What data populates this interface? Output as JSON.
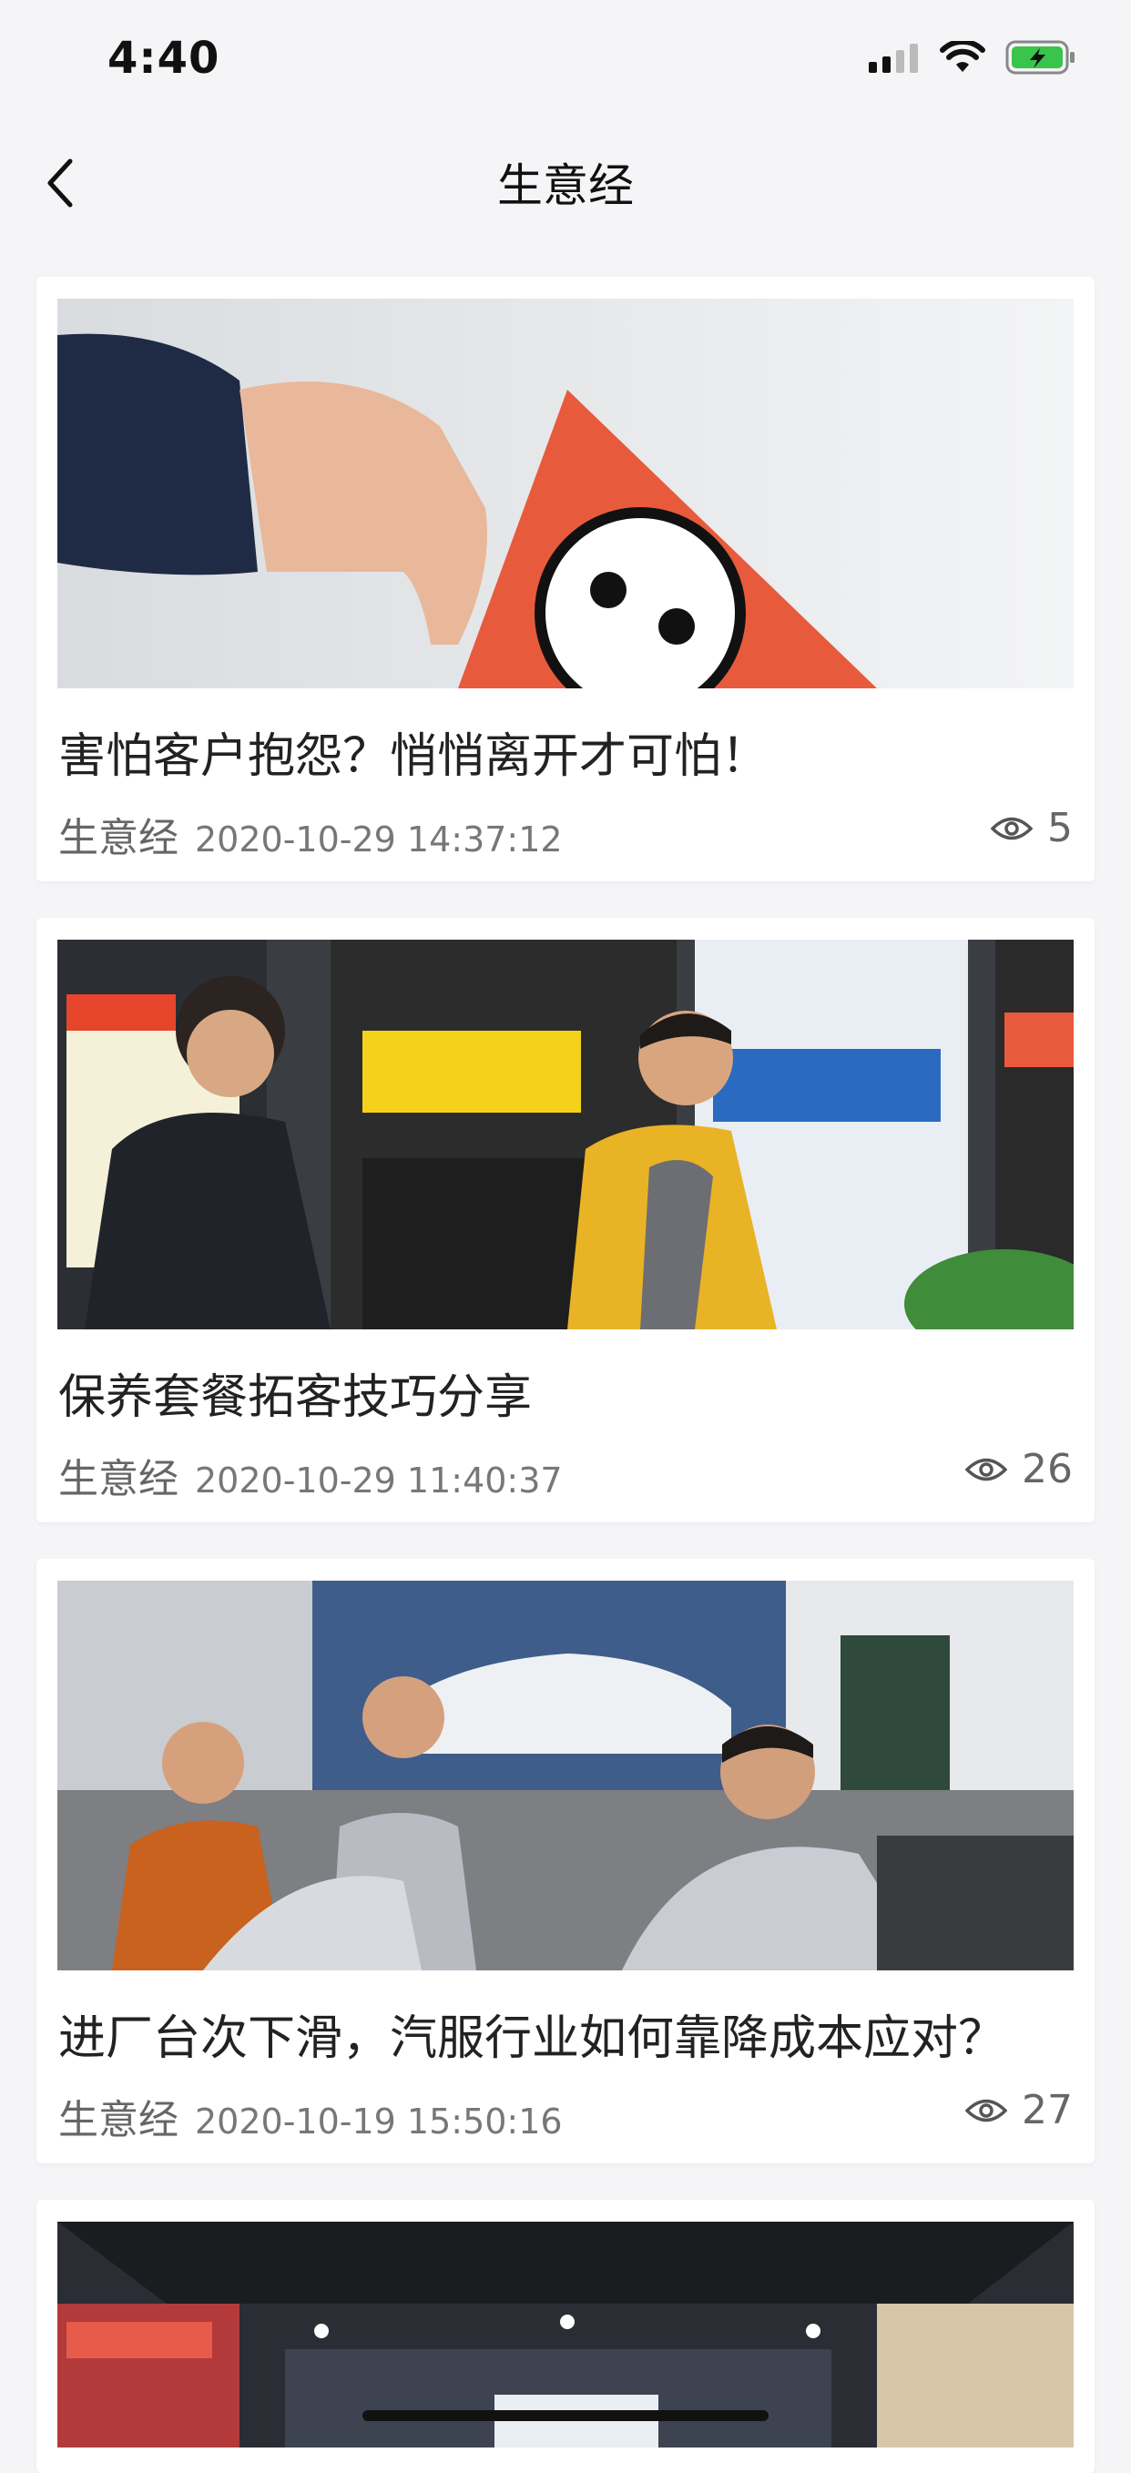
{
  "status_bar": {
    "time": "4:40",
    "icons": [
      "cellular-signal-icon",
      "wifi-icon",
      "battery-charging-icon"
    ],
    "battery_color": "#39c44b"
  },
  "nav": {
    "back_icon": "chevron-left-icon",
    "title": "生意经"
  },
  "articles": [
    {
      "title": "害怕客户抱怨？悄悄离开才可怕！",
      "category": "生意经",
      "date": "2020-10-29 14:37:12",
      "views": "5",
      "view_icon": "eye-icon",
      "image": "photo-hand-holding-sad-face-card"
    },
    {
      "title": "保养套餐拓客技巧分享",
      "category": "生意经",
      "date": "2020-10-29 11:40:37",
      "views": "26",
      "view_icon": "eye-icon",
      "image": "photo-service-advisor-maintenance-package-poster"
    },
    {
      "title": "进厂台次下滑，汽服行业如何靠降成本应对？",
      "category": "生意经",
      "date": "2020-10-19 15:50:16",
      "views": "27",
      "view_icon": "eye-icon",
      "image": "photo-mechanics-workshop-training"
    },
    {
      "image": "photo-store-interior"
    }
  ],
  "colors": {
    "background": "#f5f5f7",
    "card": "#ffffff",
    "title_text": "#222222",
    "meta_text": "#777777"
  }
}
